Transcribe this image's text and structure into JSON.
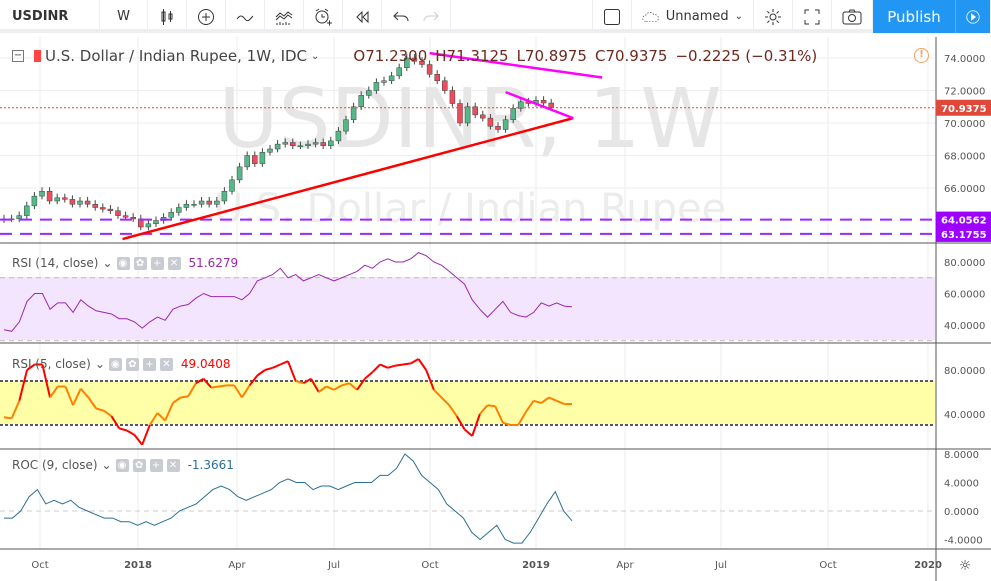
{
  "toolbar": {
    "symbol": "USDINR",
    "interval": "W",
    "layout_name": "Unnamed",
    "publish": "Publish",
    "icons": [
      "candles-icon",
      "add-compare-icon",
      "indicators-icon",
      "templates-icon",
      "alert-icon",
      "replay-icon",
      "undo-icon",
      "redo-icon",
      "layout-square-icon",
      "cloud-icon",
      "settings-icon",
      "fullscreen-icon",
      "camera-icon",
      "play-icon"
    ]
  },
  "main": {
    "title": "U.S. Dollar / Indian Rupee, 1W, IDC",
    "open": "O71.2300",
    "high": "H71.3125",
    "low": "L70.8975",
    "close": "C70.9375",
    "change": "−0.2225 (−0.31%)",
    "watermark1": "USDINR, 1W",
    "watermark2": "U.S. Dollar / Indian Rupee",
    "price_ticks": [
      "74.0000",
      "72.0000",
      "70.0000",
      "68.0000",
      "66.0000"
    ],
    "last_price": "70.9375",
    "hline1": "64.0562",
    "hline2": "63.1755"
  },
  "rsi14": {
    "label": "RSI (14, close)",
    "value": "51.6279",
    "ticks": [
      "80.0000",
      "60.0000",
      "40.0000"
    ]
  },
  "rsi5": {
    "label": "RSI (5, close)",
    "value": "49.0408",
    "ticks": [
      "80.0000",
      "40.0000"
    ]
  },
  "roc": {
    "label": "ROC (9, close)",
    "value": "-1.3661",
    "ticks": [
      "8.0000",
      "4.0000",
      "0.0000",
      "-4.0000"
    ]
  },
  "time_axis": [
    "Oct",
    "2018",
    "Apr",
    "Jul",
    "Oct",
    "2019",
    "Apr",
    "Jul",
    "Oct",
    "2020"
  ],
  "colors": {
    "up": "#53b987",
    "down": "#eb4d5c",
    "accent": "#2196f3",
    "trend": "#ff0000",
    "trend2": "#ff00ff",
    "hline": "#9c27ff",
    "rsi14": "#9c27b0",
    "rsi5_high": "#ff0000",
    "rsi5_low": "#ff7f00",
    "roc": "#2a6f97"
  },
  "chart_data": {
    "type": "candlestick",
    "close": [
      64.1,
      64.1,
      64.3,
      64.9,
      65.5,
      65.8,
      65.2,
      65.4,
      65.3,
      65.0,
      65.2,
      65.0,
      64.8,
      64.7,
      64.6,
      64.3,
      64.2,
      64.1,
      63.6,
      63.8,
      64.0,
      64.2,
      64.5,
      64.8,
      65.0,
      65.0,
      65.2,
      65.0,
      65.2,
      65.8,
      66.5,
      67.3,
      68.0,
      67.5,
      68.2,
      68.4,
      68.7,
      68.8,
      68.6,
      68.6,
      68.7,
      68.8,
      68.6,
      68.9,
      69.5,
      70.2,
      71.0,
      71.7,
      72.0,
      72.5,
      72.6,
      72.9,
      73.4,
      74.0,
      73.8,
      73.6,
      73.0,
      72.6,
      72.0,
      71.2,
      70.0,
      71.0,
      70.5,
      70.3,
      69.8,
      69.6,
      70.2,
      70.9,
      71.3,
      71.2,
      71.4,
      71.23,
      70.94
    ],
    "rsi14": [
      37,
      36,
      42,
      55,
      60,
      60,
      50,
      54,
      54,
      48,
      56,
      52,
      49,
      48,
      47,
      44,
      44,
      42,
      38,
      42,
      45,
      43,
      50,
      52,
      53,
      57,
      60,
      58,
      58,
      58,
      58,
      56,
      60,
      68,
      70,
      72,
      76,
      70,
      72,
      68,
      70,
      72,
      70,
      68,
      70,
      72,
      74,
      78,
      76,
      80,
      82,
      80,
      80,
      82,
      86,
      84,
      80,
      78,
      74,
      70,
      66,
      56,
      50,
      45,
      50,
      55,
      48,
      46,
      45,
      48,
      54,
      52,
      54,
      52,
      51.63
    ],
    "rsi5": [
      37,
      36,
      52,
      80,
      85,
      85,
      55,
      65,
      65,
      48,
      63,
      55,
      45,
      43,
      38,
      27,
      25,
      21,
      12,
      30,
      41,
      34,
      50,
      55,
      56,
      68,
      72,
      64,
      65,
      66,
      66,
      55,
      66,
      75,
      80,
      82,
      85,
      88,
      70,
      68,
      72,
      60,
      65,
      62,
      66,
      68,
      62,
      72,
      78,
      85,
      82,
      84,
      85,
      86,
      90,
      80,
      62,
      55,
      48,
      38,
      26,
      20,
      40,
      48,
      47,
      32,
      30,
      30,
      42,
      52,
      50,
      55,
      52,
      49,
      49.04
    ],
    "roc": [
      -1,
      -1,
      0,
      2,
      3,
      1,
      1.5,
      1,
      1.5,
      0.5,
      0,
      -0.5,
      -1,
      -1,
      -1.5,
      -1.5,
      -2,
      -1.5,
      -2,
      -1.5,
      -1,
      0,
      0.5,
      1,
      2,
      3,
      3.5,
      3,
      2,
      1.5,
      2,
      2.5,
      3,
      4,
      4.5,
      4,
      4,
      3,
      3.5,
      3.5,
      3,
      3.5,
      4,
      4,
      4,
      5,
      5,
      6,
      8,
      7,
      5,
      4,
      3,
      1,
      0,
      -1,
      -3,
      -4,
      -3,
      -2,
      -4,
      -4.5,
      -4.5,
      -3,
      -1,
      1,
      2.7,
      0,
      -1.37
    ],
    "trendlines": [
      {
        "from": [
          15.6,
          62.86
        ],
        "to": [
          74.9,
          70.3
        ],
        "color": "#ff0000"
      },
      {
        "from": [
          56,
          74.3
        ],
        "to": [
          78.7,
          72.8
        ],
        "color": "#ff00ff"
      },
      {
        "from": [
          66,
          71.9
        ],
        "to": [
          74.9,
          70.3
        ],
        "color": "#ff00ff"
      }
    ],
    "rsi_bands": [
      70,
      30
    ]
  }
}
